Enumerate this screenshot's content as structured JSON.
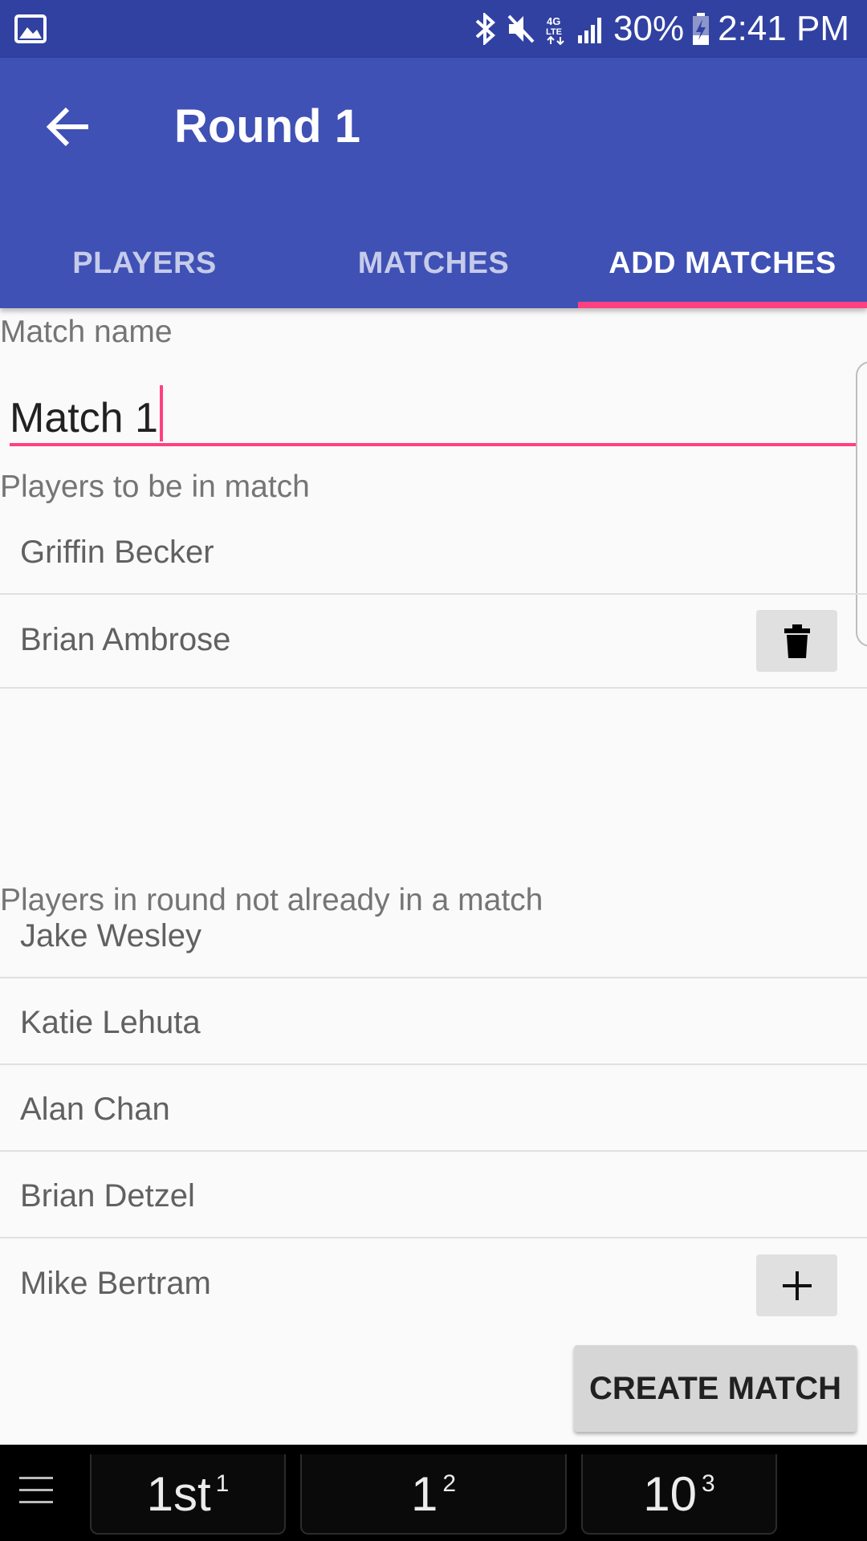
{
  "status_bar": {
    "battery": "30%",
    "time": "2:41 PM",
    "icons": [
      "image-icon",
      "bluetooth-icon",
      "mute-icon",
      "4g-lte-icon",
      "signal-icon",
      "battery-charging-icon"
    ]
  },
  "app_bar": {
    "title": "Round 1",
    "tabs": [
      {
        "label": "PLAYERS",
        "active": false
      },
      {
        "label": "MATCHES",
        "active": false
      },
      {
        "label": "ADD MATCHES",
        "active": true
      }
    ]
  },
  "form": {
    "match_name_label": "Match name",
    "match_name_value": "Match 1",
    "players_in_match_label": "Players to be in match",
    "players_in_match": [
      "Griffin Becker",
      "Brian Ambrose"
    ],
    "available_label": "Players in round not already in a match",
    "available_players": [
      "Jake Wesley",
      "Katie Lehuta",
      "Alan Chan",
      "Brian Detzel",
      "Mike Bertram"
    ],
    "create_button": "CREATE MATCH"
  },
  "keyboard_suggestions": {
    "items": [
      {
        "text": "1st",
        "index": "1"
      },
      {
        "text": "1",
        "index": "2"
      },
      {
        "text": "10",
        "index": "3"
      }
    ]
  },
  "colors": {
    "status_bar": "#3141a1",
    "primary": "#3f51b5",
    "accent": "#ff4081"
  }
}
